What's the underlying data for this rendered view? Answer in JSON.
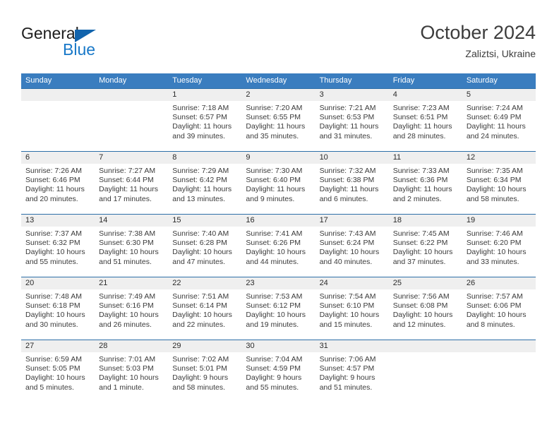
{
  "brand": {
    "name_top": "General",
    "name_bottom": "Blue",
    "top_color": "#1d1d1d",
    "bottom_color": "#1878c8",
    "triangle_color": "#1264ad"
  },
  "header": {
    "title": "October 2024",
    "subtitle": "Zaliztsi, Ukraine"
  },
  "theme": {
    "header_bg": "#3a7dbf",
    "row_rule": "#2d6fa8",
    "daynum_bg": "#efefef",
    "text": "#3a3a3a"
  },
  "weekdays": [
    "Sunday",
    "Monday",
    "Tuesday",
    "Wednesday",
    "Thursday",
    "Friday",
    "Saturday"
  ],
  "weeks": [
    [
      {
        "day": "",
        "sunrise": "",
        "sunset": "",
        "daylight": ""
      },
      {
        "day": "",
        "sunrise": "",
        "sunset": "",
        "daylight": ""
      },
      {
        "day": "1",
        "sunrise": "Sunrise: 7:18 AM",
        "sunset": "Sunset: 6:57 PM",
        "daylight": "Daylight: 11 hours and 39 minutes."
      },
      {
        "day": "2",
        "sunrise": "Sunrise: 7:20 AM",
        "sunset": "Sunset: 6:55 PM",
        "daylight": "Daylight: 11 hours and 35 minutes."
      },
      {
        "day": "3",
        "sunrise": "Sunrise: 7:21 AM",
        "sunset": "Sunset: 6:53 PM",
        "daylight": "Daylight: 11 hours and 31 minutes."
      },
      {
        "day": "4",
        "sunrise": "Sunrise: 7:23 AM",
        "sunset": "Sunset: 6:51 PM",
        "daylight": "Daylight: 11 hours and 28 minutes."
      },
      {
        "day": "5",
        "sunrise": "Sunrise: 7:24 AM",
        "sunset": "Sunset: 6:49 PM",
        "daylight": "Daylight: 11 hours and 24 minutes."
      }
    ],
    [
      {
        "day": "6",
        "sunrise": "Sunrise: 7:26 AM",
        "sunset": "Sunset: 6:46 PM",
        "daylight": "Daylight: 11 hours and 20 minutes."
      },
      {
        "day": "7",
        "sunrise": "Sunrise: 7:27 AM",
        "sunset": "Sunset: 6:44 PM",
        "daylight": "Daylight: 11 hours and 17 minutes."
      },
      {
        "day": "8",
        "sunrise": "Sunrise: 7:29 AM",
        "sunset": "Sunset: 6:42 PM",
        "daylight": "Daylight: 11 hours and 13 minutes."
      },
      {
        "day": "9",
        "sunrise": "Sunrise: 7:30 AM",
        "sunset": "Sunset: 6:40 PM",
        "daylight": "Daylight: 11 hours and 9 minutes."
      },
      {
        "day": "10",
        "sunrise": "Sunrise: 7:32 AM",
        "sunset": "Sunset: 6:38 PM",
        "daylight": "Daylight: 11 hours and 6 minutes."
      },
      {
        "day": "11",
        "sunrise": "Sunrise: 7:33 AM",
        "sunset": "Sunset: 6:36 PM",
        "daylight": "Daylight: 11 hours and 2 minutes."
      },
      {
        "day": "12",
        "sunrise": "Sunrise: 7:35 AM",
        "sunset": "Sunset: 6:34 PM",
        "daylight": "Daylight: 10 hours and 58 minutes."
      }
    ],
    [
      {
        "day": "13",
        "sunrise": "Sunrise: 7:37 AM",
        "sunset": "Sunset: 6:32 PM",
        "daylight": "Daylight: 10 hours and 55 minutes."
      },
      {
        "day": "14",
        "sunrise": "Sunrise: 7:38 AM",
        "sunset": "Sunset: 6:30 PM",
        "daylight": "Daylight: 10 hours and 51 minutes."
      },
      {
        "day": "15",
        "sunrise": "Sunrise: 7:40 AM",
        "sunset": "Sunset: 6:28 PM",
        "daylight": "Daylight: 10 hours and 47 minutes."
      },
      {
        "day": "16",
        "sunrise": "Sunrise: 7:41 AM",
        "sunset": "Sunset: 6:26 PM",
        "daylight": "Daylight: 10 hours and 44 minutes."
      },
      {
        "day": "17",
        "sunrise": "Sunrise: 7:43 AM",
        "sunset": "Sunset: 6:24 PM",
        "daylight": "Daylight: 10 hours and 40 minutes."
      },
      {
        "day": "18",
        "sunrise": "Sunrise: 7:45 AM",
        "sunset": "Sunset: 6:22 PM",
        "daylight": "Daylight: 10 hours and 37 minutes."
      },
      {
        "day": "19",
        "sunrise": "Sunrise: 7:46 AM",
        "sunset": "Sunset: 6:20 PM",
        "daylight": "Daylight: 10 hours and 33 minutes."
      }
    ],
    [
      {
        "day": "20",
        "sunrise": "Sunrise: 7:48 AM",
        "sunset": "Sunset: 6:18 PM",
        "daylight": "Daylight: 10 hours and 30 minutes."
      },
      {
        "day": "21",
        "sunrise": "Sunrise: 7:49 AM",
        "sunset": "Sunset: 6:16 PM",
        "daylight": "Daylight: 10 hours and 26 minutes."
      },
      {
        "day": "22",
        "sunrise": "Sunrise: 7:51 AM",
        "sunset": "Sunset: 6:14 PM",
        "daylight": "Daylight: 10 hours and 22 minutes."
      },
      {
        "day": "23",
        "sunrise": "Sunrise: 7:53 AM",
        "sunset": "Sunset: 6:12 PM",
        "daylight": "Daylight: 10 hours and 19 minutes."
      },
      {
        "day": "24",
        "sunrise": "Sunrise: 7:54 AM",
        "sunset": "Sunset: 6:10 PM",
        "daylight": "Daylight: 10 hours and 15 minutes."
      },
      {
        "day": "25",
        "sunrise": "Sunrise: 7:56 AM",
        "sunset": "Sunset: 6:08 PM",
        "daylight": "Daylight: 10 hours and 12 minutes."
      },
      {
        "day": "26",
        "sunrise": "Sunrise: 7:57 AM",
        "sunset": "Sunset: 6:06 PM",
        "daylight": "Daylight: 10 hours and 8 minutes."
      }
    ],
    [
      {
        "day": "27",
        "sunrise": "Sunrise: 6:59 AM",
        "sunset": "Sunset: 5:05 PM",
        "daylight": "Daylight: 10 hours and 5 minutes."
      },
      {
        "day": "28",
        "sunrise": "Sunrise: 7:01 AM",
        "sunset": "Sunset: 5:03 PM",
        "daylight": "Daylight: 10 hours and 1 minute."
      },
      {
        "day": "29",
        "sunrise": "Sunrise: 7:02 AM",
        "sunset": "Sunset: 5:01 PM",
        "daylight": "Daylight: 9 hours and 58 minutes."
      },
      {
        "day": "30",
        "sunrise": "Sunrise: 7:04 AM",
        "sunset": "Sunset: 4:59 PM",
        "daylight": "Daylight: 9 hours and 55 minutes."
      },
      {
        "day": "31",
        "sunrise": "Sunrise: 7:06 AM",
        "sunset": "Sunset: 4:57 PM",
        "daylight": "Daylight: 9 hours and 51 minutes."
      },
      {
        "day": "",
        "sunrise": "",
        "sunset": "",
        "daylight": ""
      },
      {
        "day": "",
        "sunrise": "",
        "sunset": "",
        "daylight": ""
      }
    ]
  ]
}
